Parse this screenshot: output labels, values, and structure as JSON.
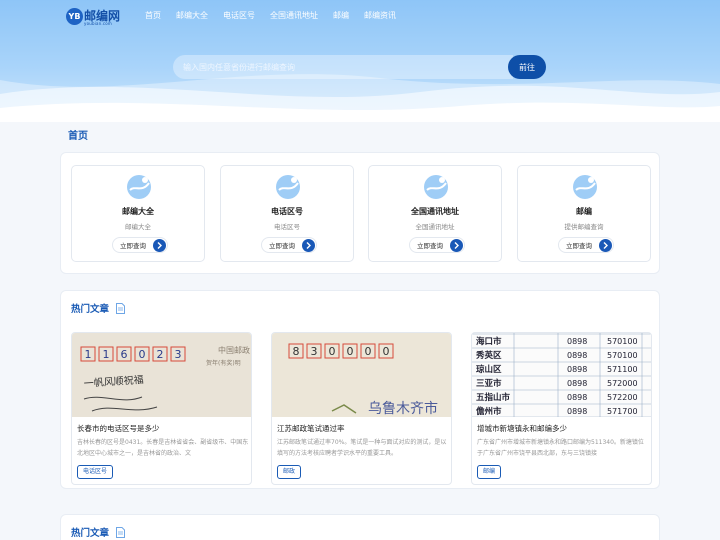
{
  "logo": {
    "badge": "YB",
    "text": "邮编网",
    "sub": "youbian.com"
  },
  "nav": {
    "items": [
      "首页",
      "邮编大全",
      "电话区号",
      "全国通讯地址",
      "邮编",
      "邮编资讯"
    ]
  },
  "search": {
    "placeholder": "输入国内任意省份进行邮编查询",
    "button": "前往"
  },
  "page_title": "首页",
  "cards": [
    {
      "title": "邮编大全",
      "desc": "邮编大全",
      "button": "立即查询"
    },
    {
      "title": "电话区号",
      "desc": "电话区号",
      "button": "立即查询"
    },
    {
      "title": "全国通讯地址",
      "desc": "全国通讯地址",
      "button": "立即查询"
    },
    {
      "title": "邮编",
      "desc": "提供邮编查询",
      "button": "立即查询"
    }
  ],
  "hot_articles": {
    "heading": "热门文章",
    "items": [
      {
        "title": "长春市的电话区号是多少",
        "summary": "吉林长春的区号是0431。长春是吉林省省会、副省级市、中国东北地区中心城市之一，是吉林省的政治、文",
        "tag": "电话区号",
        "thumb": {
          "digits": [
            "1",
            "1",
            "6",
            "0",
            "2",
            "3"
          ],
          "print": "中国邮政",
          "print2": "贺年(有奖)明",
          "hand": "一帆风顺祝福"
        }
      },
      {
        "title": "江苏邮政笔试通过率",
        "summary": "江苏邮政笔试通过率70%。笔试是一种与面试对应的测试，是以填写的方法考核应聘者学识水平的重要工具。",
        "tag": "邮政",
        "thumb": {
          "digits": [
            "8",
            "3",
            "0",
            "0",
            "0",
            "0"
          ],
          "hand": "乌鲁木齐市"
        }
      },
      {
        "title": "增城市新塘镇永和邮编多少",
        "summary": "广东省广州市增城市新塘镇永和路口邮编为511340。新塘镇位于广东省广州市饶平县西北部，东与三饶镇接",
        "tag": "邮编",
        "thumb": {
          "rows": [
            [
              "海口市",
              "0898",
              "570100"
            ],
            [
              "秀英区",
              "0898",
              "570100"
            ],
            [
              "琼山区",
              "0898",
              "571100"
            ],
            [
              "三亚市",
              "0898",
              "572000"
            ],
            [
              "五指山市",
              "0898",
              "572200"
            ],
            [
              "儋州市",
              "0898",
              "571700"
            ]
          ]
        }
      }
    ]
  },
  "hot_articles_2": {
    "heading": "热门文章"
  },
  "colors": {
    "brand": "#1a5bb5",
    "button": "#0e4fa8",
    "hero": "#a9d4fa"
  }
}
